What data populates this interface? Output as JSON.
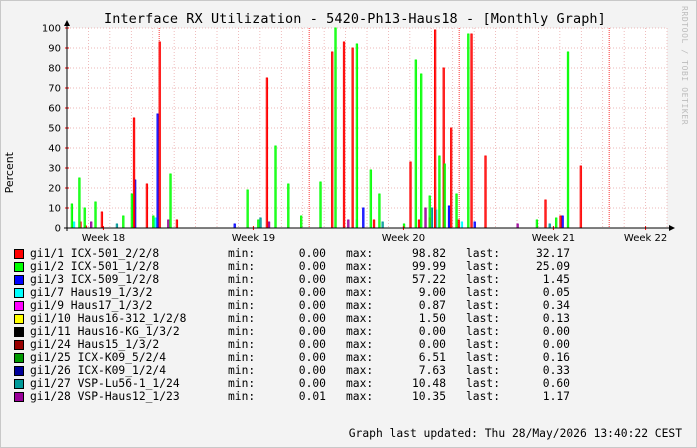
{
  "chart_data": {
    "type": "line",
    "title": "Interface RX Utilization - 5420-Ph13-Haus18 - [Monthly Graph]",
    "ylabel": "Percent",
    "xlabel": "",
    "ylim": [
      0,
      100
    ],
    "yticks": [
      0,
      10,
      20,
      30,
      40,
      50,
      60,
      70,
      80,
      90,
      100
    ],
    "xticks": [
      "Week 18",
      "Week 19",
      "Week 20",
      "Week 21",
      "Week 22"
    ],
    "grid": true,
    "legend_placement": "bottom",
    "series": [
      {
        "name": "gi1/1 ICX-501_2/2/8",
        "color": "#ff0000",
        "min": "0.00",
        "max": "98.82",
        "last": "32.17"
      },
      {
        "name": "gi1/2 ICX-501_1/2/8",
        "color": "#00ff00",
        "min": "0.00",
        "max": "99.99",
        "last": "25.09"
      },
      {
        "name": "gi1/3 ICX-509_1/2/8",
        "color": "#0000ff",
        "min": "0.00",
        "max": "57.22",
        "last": "1.45"
      },
      {
        "name": "gi1/7 Haus19_1/3/2",
        "color": "#00ffff",
        "min": "0.00",
        "max": "9.00",
        "last": "0.05"
      },
      {
        "name": "gi1/9 Haus17_1/3/2",
        "color": "#ff00ff",
        "min": "0.00",
        "max": "0.87",
        "last": "0.34"
      },
      {
        "name": "gi1/10 Haus16-312_1/2/8",
        "color": "#ffff00",
        "min": "0.00",
        "max": "1.50",
        "last": "0.13"
      },
      {
        "name": "gi1/11 Haus16-KG_1/3/2",
        "color": "#000000",
        "min": "0.00",
        "max": "0.00",
        "last": "0.00"
      },
      {
        "name": "gi1/24 Haus15_1/3/2",
        "color": "#990000",
        "min": "0.00",
        "max": "0.00",
        "last": "0.00"
      },
      {
        "name": "gi1/25 ICX-K09_5/2/4",
        "color": "#009900",
        "min": "0.00",
        "max": "6.51",
        "last": "0.16"
      },
      {
        "name": "gi1/26 ICX-K09_1/2/4",
        "color": "#000099",
        "min": "0.00",
        "max": "7.63",
        "last": "0.33"
      },
      {
        "name": "gi1/27 VSP-Lu56-1_1/24",
        "color": "#009999",
        "min": "0.00",
        "max": "10.48",
        "last": "0.60"
      },
      {
        "name": "gi1/28 VSP-Haus12_1/23",
        "color": "#990099",
        "min": "0.01",
        "max": "10.35",
        "last": "1.17"
      }
    ],
    "spikes": {
      "gi1/1 ICX-501_2/2/8": [
        [
          0.6,
          3
        ],
        [
          0.85,
          1
        ],
        [
          1.6,
          8
        ],
        [
          3.1,
          55
        ],
        [
          3.7,
          22
        ],
        [
          4.3,
          93
        ],
        [
          5.1,
          4
        ],
        [
          9.3,
          75
        ],
        [
          12.35,
          88
        ],
        [
          12.9,
          93
        ],
        [
          13.3,
          90
        ],
        [
          14.3,
          4
        ],
        [
          16.0,
          33
        ],
        [
          16.4,
          4
        ],
        [
          16.9,
          5
        ],
        [
          17.15,
          99
        ],
        [
          17.55,
          80
        ],
        [
          17.9,
          50
        ],
        [
          18.25,
          4
        ],
        [
          18.85,
          97
        ],
        [
          19.5,
          36
        ],
        [
          22.3,
          14
        ],
        [
          23.0,
          6
        ],
        [
          23.95,
          31
        ]
      ],
      "gi1/2 ICX-501_1/2/8": [
        [
          0.2,
          12
        ],
        [
          0.55,
          25
        ],
        [
          0.8,
          10
        ],
        [
          1.3,
          13
        ],
        [
          2.6,
          6
        ],
        [
          3.0,
          17
        ],
        [
          4.0,
          6
        ],
        [
          4.8,
          27
        ],
        [
          8.4,
          19
        ],
        [
          8.9,
          4
        ],
        [
          9.7,
          41
        ],
        [
          10.3,
          22
        ],
        [
          10.9,
          6
        ],
        [
          11.8,
          23
        ],
        [
          12.5,
          100
        ],
        [
          13.5,
          92
        ],
        [
          14.15,
          29
        ],
        [
          14.55,
          17
        ],
        [
          15.7,
          2
        ],
        [
          16.25,
          84
        ],
        [
          16.5,
          77
        ],
        [
          16.9,
          16
        ],
        [
          17.35,
          36
        ],
        [
          17.6,
          32
        ],
        [
          18.15,
          17
        ],
        [
          18.7,
          97
        ],
        [
          21.9,
          4
        ],
        [
          22.8,
          5
        ],
        [
          23.35,
          88
        ]
      ],
      "gi1/3 ICX-509_1/2/8": [
        [
          3.15,
          24
        ],
        [
          4.2,
          57
        ],
        [
          7.8,
          2
        ],
        [
          13.8,
          10
        ],
        [
          17.8,
          11
        ],
        [
          19.0,
          3
        ],
        [
          23.1,
          6
        ]
      ],
      "gi1/7 Haus19_1/3/2": [
        [
          0.3,
          3
        ],
        [
          4.1,
          5
        ],
        [
          13.5,
          4
        ],
        [
          17.2,
          9
        ],
        [
          18.4,
          3
        ]
      ],
      "gi1/27 VSP-Lu56-1_1/24": [
        [
          2.3,
          2
        ],
        [
          9.0,
          5
        ],
        [
          14.7,
          3
        ],
        [
          17.0,
          10
        ],
        [
          22.5,
          2
        ]
      ],
      "gi1/28 VSP-Haus12_1/23": [
        [
          1.1,
          3
        ],
        [
          4.7,
          4
        ],
        [
          9.4,
          3
        ],
        [
          13.1,
          4
        ],
        [
          16.7,
          10
        ],
        [
          21.0,
          2
        ]
      ]
    }
  },
  "watermark": "RRDTOOL / TOBI OETIKER",
  "legend_labels": {
    "min": "min:",
    "max": "max:",
    "last": "last:"
  },
  "footer": "Graph last updated: Thu 28/May/2026 13:40:22 CEST"
}
